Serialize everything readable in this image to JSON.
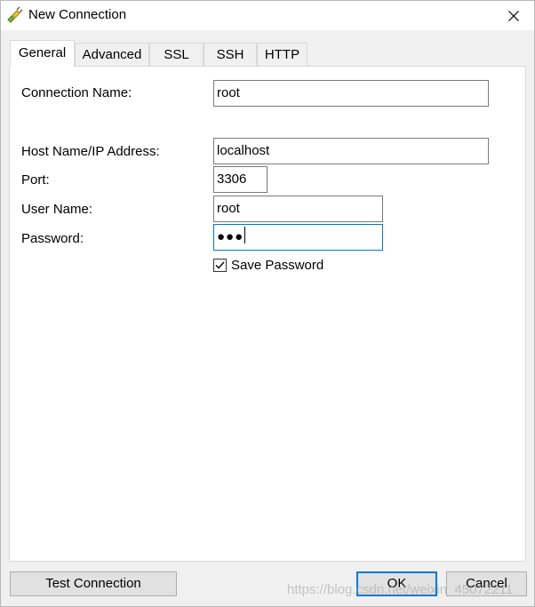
{
  "window": {
    "title": "New Connection"
  },
  "tabs": [
    {
      "label": "General",
      "active": true
    },
    {
      "label": "Advanced",
      "active": false
    },
    {
      "label": "SSL",
      "active": false
    },
    {
      "label": "SSH",
      "active": false
    },
    {
      "label": "HTTP",
      "active": false
    }
  ],
  "form": {
    "connection_name": {
      "label": "Connection Name:",
      "value": "root"
    },
    "host": {
      "label": "Host Name/IP Address:",
      "value": "localhost"
    },
    "port": {
      "label": "Port:",
      "value": "3306"
    },
    "user": {
      "label": "User Name:",
      "value": "root"
    },
    "password": {
      "label": "Password:",
      "masked_value": "●●●"
    },
    "save_password": {
      "label": "Save Password",
      "checked": true
    }
  },
  "buttons": {
    "test_connection": "Test Connection",
    "ok": "OK",
    "cancel": "Cancel"
  },
  "watermark": "https://blog.csdn.net/weixin_45072211",
  "colors": {
    "focus": "#0078d7",
    "window_bg": "#f0f0f0"
  }
}
